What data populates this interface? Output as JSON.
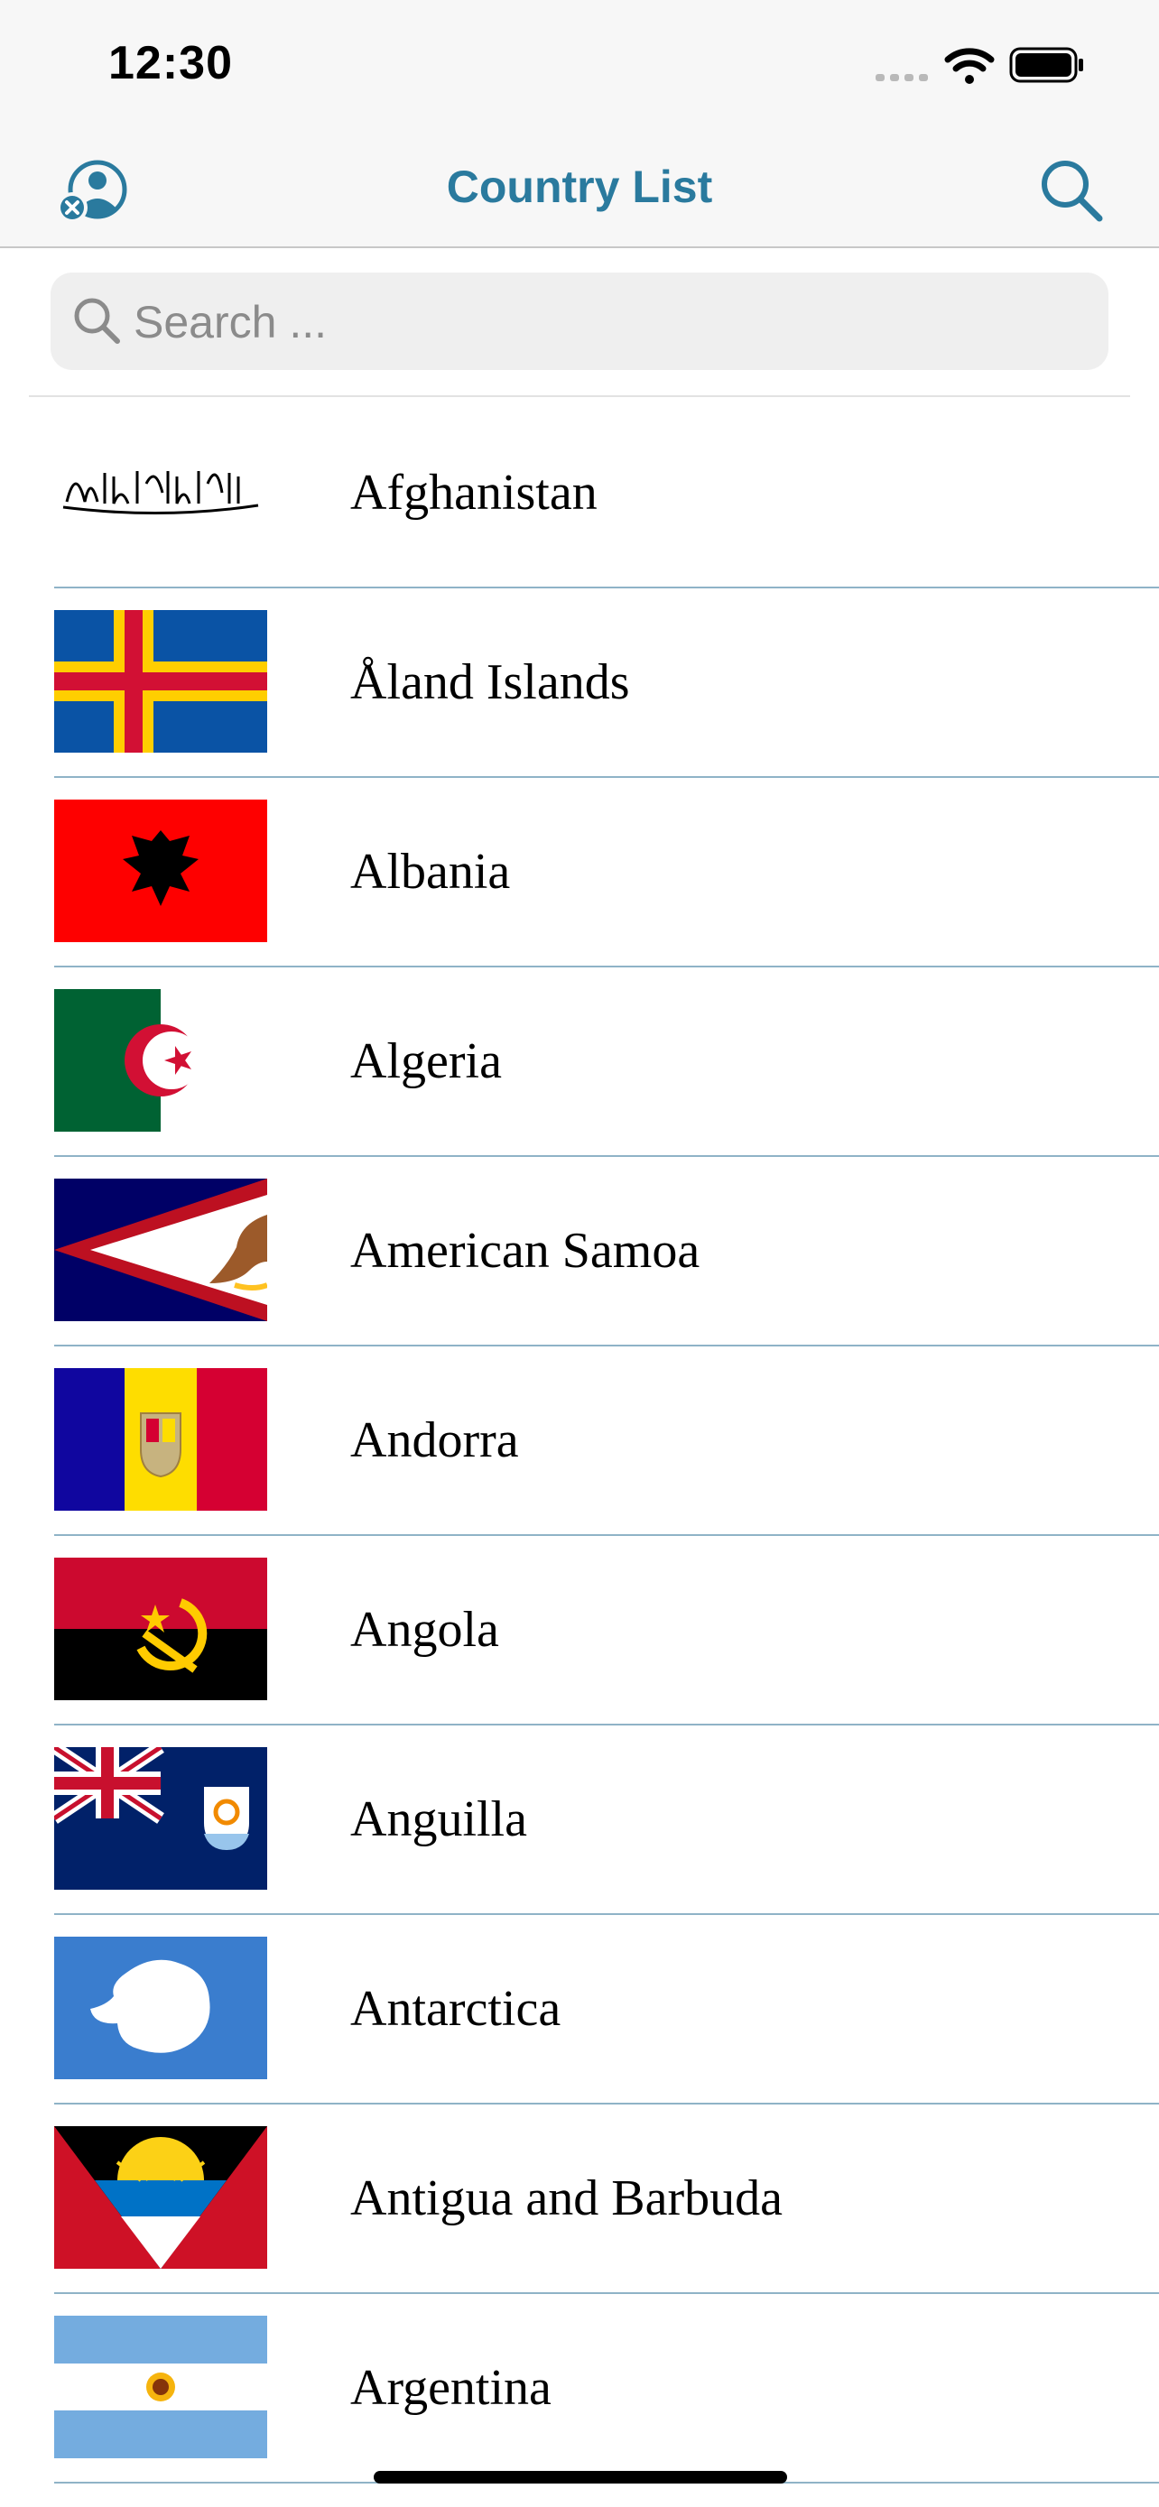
{
  "status_bar": {
    "time": "12:30"
  },
  "nav": {
    "title": "Country List",
    "left_icon": "person-circle-x-icon",
    "right_icon": "search-icon"
  },
  "search": {
    "placeholder": "Search ...",
    "value": ""
  },
  "countries": [
    {
      "name": "Afghanistan"
    },
    {
      "name": "Åland Islands"
    },
    {
      "name": "Albania"
    },
    {
      "name": "Algeria"
    },
    {
      "name": "American Samoa"
    },
    {
      "name": "Andorra"
    },
    {
      "name": "Angola"
    },
    {
      "name": "Anguilla"
    },
    {
      "name": "Antarctica"
    },
    {
      "name": "Antigua and Barbuda"
    },
    {
      "name": "Argentina"
    }
  ],
  "colors": {
    "accent": "#2a7a9e",
    "separator": "#8fb3c7",
    "nav_background": "#f7f7f7"
  }
}
